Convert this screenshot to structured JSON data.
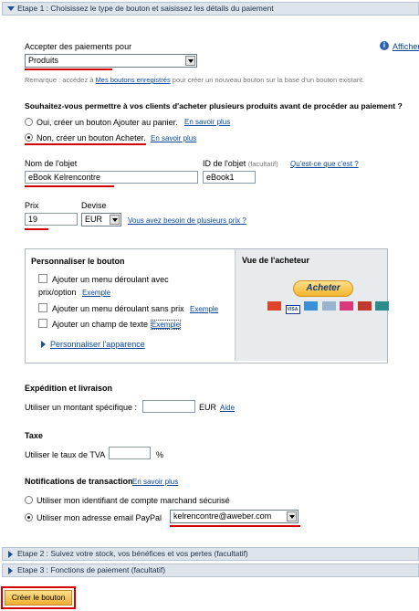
{
  "step1": {
    "title": "Etape 1 : Choisissez le type de bouton et saisissez les détails du paiement"
  },
  "accept": {
    "label": "Accepter des paiements pour",
    "selected": "Produits",
    "help_link": "Afficher",
    "remark_prefix": "Remarque : accédez à",
    "remark_link": "Mes boutons enregistrés",
    "remark_suffix": "pour créer un nouveau bouton sur la base d'un bouton existant."
  },
  "multi": {
    "question": "Souhaitez-vous permettre à vos clients d'acheter plusieurs produits avant de procéder au paiement ?",
    "option_yes": "Oui, créer un bouton Ajouter au panier.",
    "option_no": "Non, créer un bouton Acheter.",
    "learn_more": "En savoir plus"
  },
  "item": {
    "name_label": "Nom de l'objet",
    "name_value": "eBook Kelrencontre",
    "id_label": "ID de l'objet",
    "id_optional": "(facultatif)",
    "id_value": "eBook1",
    "id_help": "Qu'est-ce que c'est ?"
  },
  "price": {
    "label": "Prix",
    "value": "19",
    "currency_label": "Devise",
    "currency": "EUR",
    "multi_price_link": "Vous avez besoin de plusieurs prix ?"
  },
  "customize": {
    "title": "Personnaliser le bouton",
    "opt1_line1": "Ajouter un menu déroulant avec",
    "opt1_line2": "prix/option",
    "opt2": "Ajouter un menu déroulant sans prix",
    "opt3": "Ajouter un champ de texte",
    "example": "Exemple",
    "appearance_link": "Personnaliser l'apparence"
  },
  "preview": {
    "title": "Vue de l'acheteur",
    "button_label": "Acheter",
    "card_labels": [
      "MasterCard",
      "VISA",
      "Amex",
      "Bank",
      "Card",
      "Card",
      "Card"
    ]
  },
  "shipping": {
    "title": "Expédition et livraison",
    "label": "Utiliser un montant spécifique :",
    "value": "",
    "currency": "EUR",
    "help": "Aide"
  },
  "tax": {
    "title": "Taxe",
    "label": "Utiliser le taux de TVA",
    "value": "",
    "unit": "%"
  },
  "notify": {
    "title": "Notifications de transaction",
    "learn_more": "En savoir plus",
    "option_secure": "Utiliser mon identifiant de compte marchand sécurisé",
    "option_email": "Utiliser mon adresse email PayPal",
    "email": "kelrencontre@aweber.com"
  },
  "step2": {
    "title": "Etape 2 : Suivez votre stock, vos bénéfices et vos pertes (facultatif)"
  },
  "step3": {
    "title": "Etape 3 : Fonctions de paiement (facultatif)"
  },
  "create_button": {
    "label": "Créer le bouton"
  },
  "colors": {
    "accent": "#d40000",
    "link": "#08469e",
    "bar": "#dde4ec",
    "create": "#f3c14a"
  }
}
